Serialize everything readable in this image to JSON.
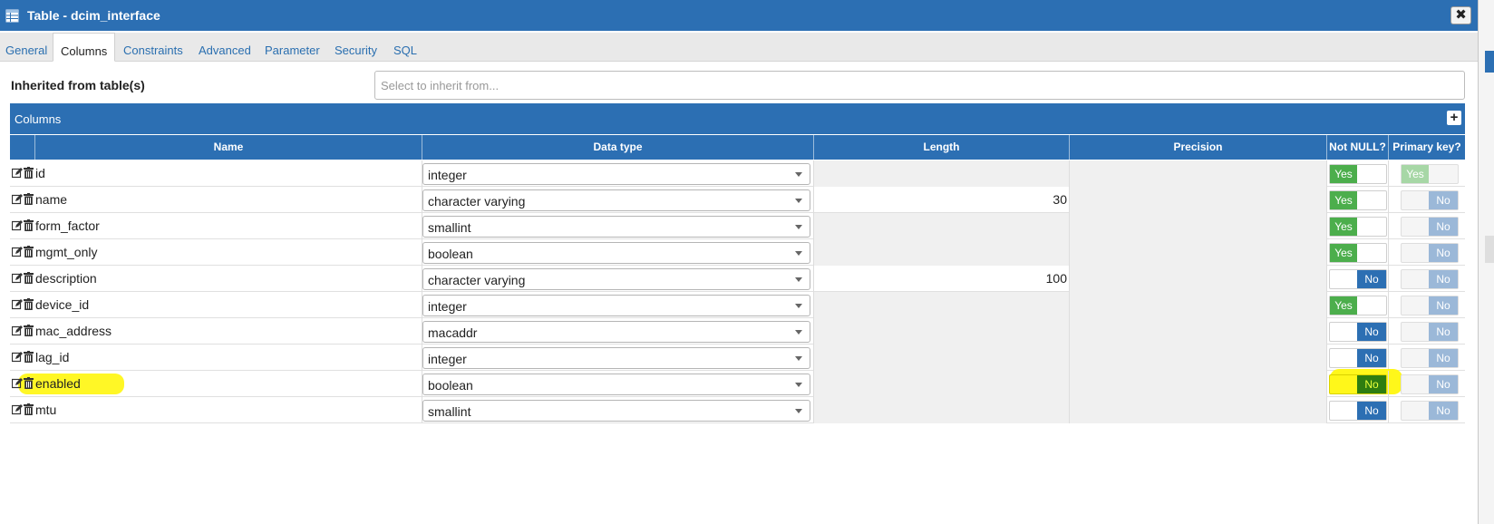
{
  "window": {
    "title": "Table - dcim_interface",
    "close_label": "✖"
  },
  "tabs": [
    {
      "label": "General"
    },
    {
      "label": "Columns"
    },
    {
      "label": "Constraints"
    },
    {
      "label": "Advanced"
    },
    {
      "label": "Parameter"
    },
    {
      "label": "Security"
    },
    {
      "label": "SQL"
    }
  ],
  "inherit": {
    "label": "Inherited from table(s)",
    "placeholder": "Select to inherit from..."
  },
  "columns_panel": {
    "title": "Columns",
    "add_label": "+"
  },
  "headers": {
    "name": "Name",
    "data_type": "Data type",
    "length": "Length",
    "precision": "Precision",
    "not_null": "Not NULL?",
    "primary_key": "Primary key?"
  },
  "toggle_labels": {
    "yes": "Yes",
    "no": "No"
  },
  "rows": [
    {
      "name": "id",
      "type": "integer",
      "length": "",
      "precision": "",
      "not_null": "Yes",
      "pk": "Yes"
    },
    {
      "name": "name",
      "type": "character varying",
      "length": "30",
      "precision": "",
      "not_null": "Yes",
      "pk": "No"
    },
    {
      "name": "form_factor",
      "type": "smallint",
      "length": "",
      "precision": "",
      "not_null": "Yes",
      "pk": "No"
    },
    {
      "name": "mgmt_only",
      "type": "boolean",
      "length": "",
      "precision": "",
      "not_null": "Yes",
      "pk": "No"
    },
    {
      "name": "description",
      "type": "character varying",
      "length": "100",
      "precision": "",
      "not_null": "No",
      "pk": "No"
    },
    {
      "name": "device_id",
      "type": "integer",
      "length": "",
      "precision": "",
      "not_null": "Yes",
      "pk": "No"
    },
    {
      "name": "mac_address",
      "type": "macaddr",
      "length": "",
      "precision": "",
      "not_null": "No",
      "pk": "No"
    },
    {
      "name": "lag_id",
      "type": "integer",
      "length": "",
      "precision": "",
      "not_null": "No",
      "pk": "No"
    },
    {
      "name": "enabled",
      "type": "boolean",
      "length": "",
      "precision": "",
      "not_null": "No",
      "pk": "No",
      "highlighted": true
    },
    {
      "name": "mtu",
      "type": "smallint",
      "length": "",
      "precision": "",
      "not_null": "No",
      "pk": "No"
    }
  ],
  "colors": {
    "accent": "#2c6fb3",
    "yes": "#4cae4c",
    "highlight": "#fff71a"
  }
}
